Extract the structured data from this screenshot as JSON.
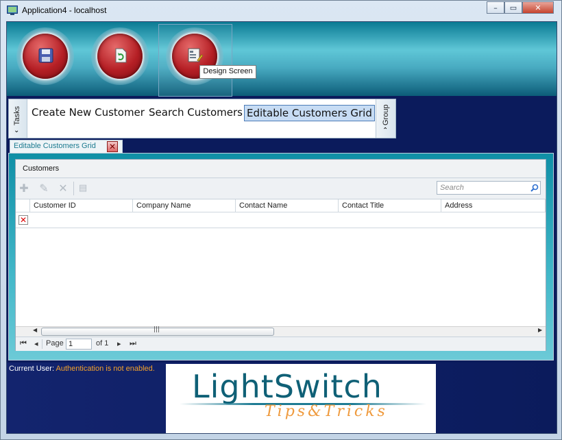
{
  "window": {
    "title": "Application4 - localhost"
  },
  "ribbon": {
    "tooltip": "Design Screen"
  },
  "tasks": {
    "tab_label": "Tasks",
    "group_label": "Group",
    "items": [
      {
        "label": "Create New Customer"
      },
      {
        "label": "Search Customers"
      },
      {
        "label": "Editable Customers Grid"
      }
    ]
  },
  "document_tab": {
    "label": "Editable Customers Grid"
  },
  "grid": {
    "title": "Customers",
    "search_placeholder": "Search",
    "columns": [
      "Customer ID",
      "Company Name",
      "Contact Name",
      "Contact Title",
      "Address"
    ]
  },
  "pager": {
    "page_label": "Page",
    "page_value": "1",
    "of_label": "of 1"
  },
  "status": {
    "user_label": "Current User:",
    "user_value": "Authentication is not enabled."
  },
  "logo": {
    "title": "LightSwitch",
    "subtitle": "Tips&Tricks"
  }
}
